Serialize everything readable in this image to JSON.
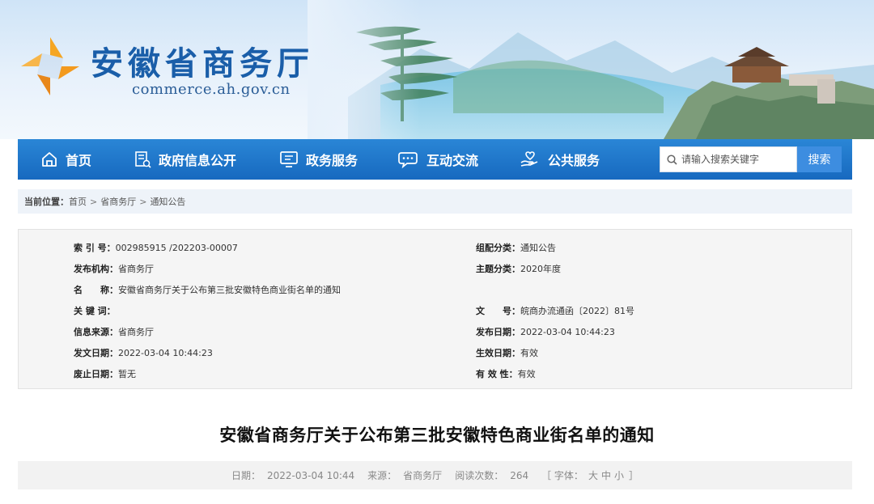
{
  "header": {
    "site_title": "安徽省商务厅",
    "site_domain": "commerce.ah.gov.cn"
  },
  "nav": {
    "items": [
      {
        "label": "首页",
        "icon": "home-icon"
      },
      {
        "label": "政府信息公开",
        "icon": "document-list-icon"
      },
      {
        "label": "政务服务",
        "icon": "monitor-icon"
      },
      {
        "label": "互动交流",
        "icon": "chat-bubble-icon"
      },
      {
        "label": "公共服务",
        "icon": "hand-heart-icon"
      }
    ],
    "search_placeholder": "请输入搜索关键字",
    "search_button": "搜索"
  },
  "breadcrumb": {
    "label": "当前位置：",
    "items": [
      "首页",
      "省商务厅",
      "通知公告"
    ],
    "separator": ">"
  },
  "meta": {
    "left": [
      {
        "key": "索 引 号：",
        "value": "002985915 /202203-00007"
      },
      {
        "key": "发布机构：",
        "value": "省商务厅"
      },
      {
        "key": "名　　称：",
        "value": "安徽省商务厅关于公布第三批安徽特色商业街名单的通知"
      },
      {
        "key": "关 键 词：",
        "value": ""
      },
      {
        "key": "信息来源：",
        "value": "省商务厅"
      },
      {
        "key": "发文日期：",
        "value": "2022-03-04 10:44:23"
      },
      {
        "key": "废止日期：",
        "value": "暂无"
      }
    ],
    "right": [
      {
        "key": "组配分类：",
        "value": "通知公告"
      },
      {
        "key": "主题分类：",
        "value": "2020年度"
      },
      {
        "key": "文　　号：",
        "value": "皖商办流通函〔2022〕81号"
      },
      {
        "key": "发布日期：",
        "value": "2022-03-04 10:44:23"
      },
      {
        "key": "生效日期：",
        "value": "有效"
      },
      {
        "key": "有 效 性：",
        "value": "有效"
      }
    ]
  },
  "article": {
    "title": "安徽省商务厅关于公布第三批安徽特色商业街名单的通知",
    "date_label": "日期：",
    "date": "2022-03-04 10:44",
    "source_label": "来源：",
    "source": "省商务厅",
    "views_label": "阅读次数：",
    "views": "264",
    "font_label_open": "［ 字体：",
    "font_large": "大",
    "font_medium": "中",
    "font_small": "小",
    "font_label_close": "］"
  },
  "colors": {
    "brand_blue": "#1a5ea9",
    "nav_blue": "#1769bf",
    "search_button": "#3d8de0",
    "logo_orange": "#f39a1e"
  }
}
